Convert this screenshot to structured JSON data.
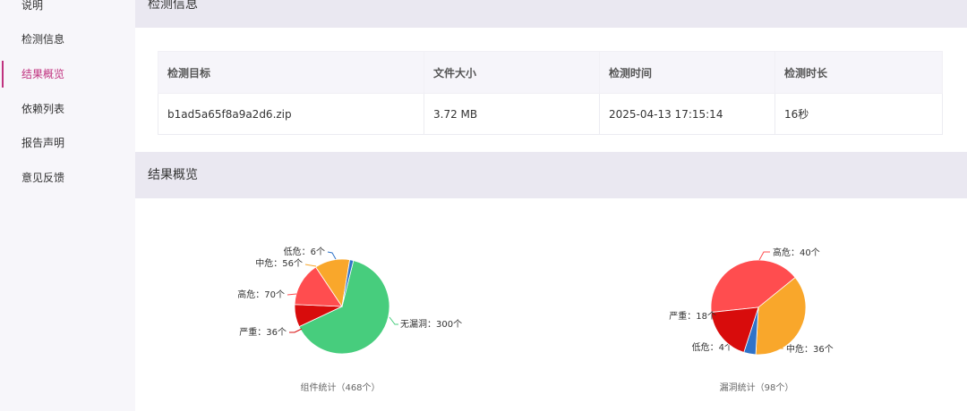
{
  "sidebar": {
    "items": [
      {
        "label": "说明",
        "active": false
      },
      {
        "label": "检测信息",
        "active": false
      },
      {
        "label": "结果概览",
        "active": true
      },
      {
        "label": "依赖列表",
        "active": false
      },
      {
        "label": "报告声明",
        "active": false
      },
      {
        "label": "意见反馈",
        "active": false
      }
    ]
  },
  "detection": {
    "title": "检测信息",
    "headers": [
      "检测目标",
      "文件大小",
      "检测时间",
      "检测时长"
    ],
    "row": [
      "b1ad5a65f8a9a2d6.zip",
      "3.72 MB",
      "2025-04-13 17:15:14",
      "16秒"
    ]
  },
  "overview": {
    "title": "结果概览"
  },
  "colors": {
    "accent": "#c0327f",
    "none": "#47cd7d",
    "severe": "#d80c0c",
    "high": "#ff4d4f",
    "medium": "#f9a72b",
    "low": "#2f73c9"
  },
  "chart_data": [
    {
      "type": "pie",
      "title": "组件统计（468个）",
      "slices": [
        {
          "label": "无漏洞：300个",
          "value": 300,
          "color": "#47cd7d"
        },
        {
          "label": "严重：36个",
          "value": 36,
          "color": "#d80c0c"
        },
        {
          "label": "高危：70个",
          "value": 70,
          "color": "#ff4d4f"
        },
        {
          "label": "中危：56个",
          "value": 56,
          "color": "#f9a72b"
        },
        {
          "label": "低危：6个",
          "value": 6,
          "color": "#2f73c9"
        }
      ]
    },
    {
      "type": "pie",
      "title": "漏洞统计（98个）",
      "slices": [
        {
          "label": "高危：40个",
          "value": 40,
          "color": "#ff4d4f"
        },
        {
          "label": "中危：36个",
          "value": 36,
          "color": "#f9a72b"
        },
        {
          "label": "低危：4个",
          "value": 4,
          "color": "#2f73c9"
        },
        {
          "label": "严重：18个",
          "value": 18,
          "color": "#d80c0c"
        }
      ]
    }
  ]
}
